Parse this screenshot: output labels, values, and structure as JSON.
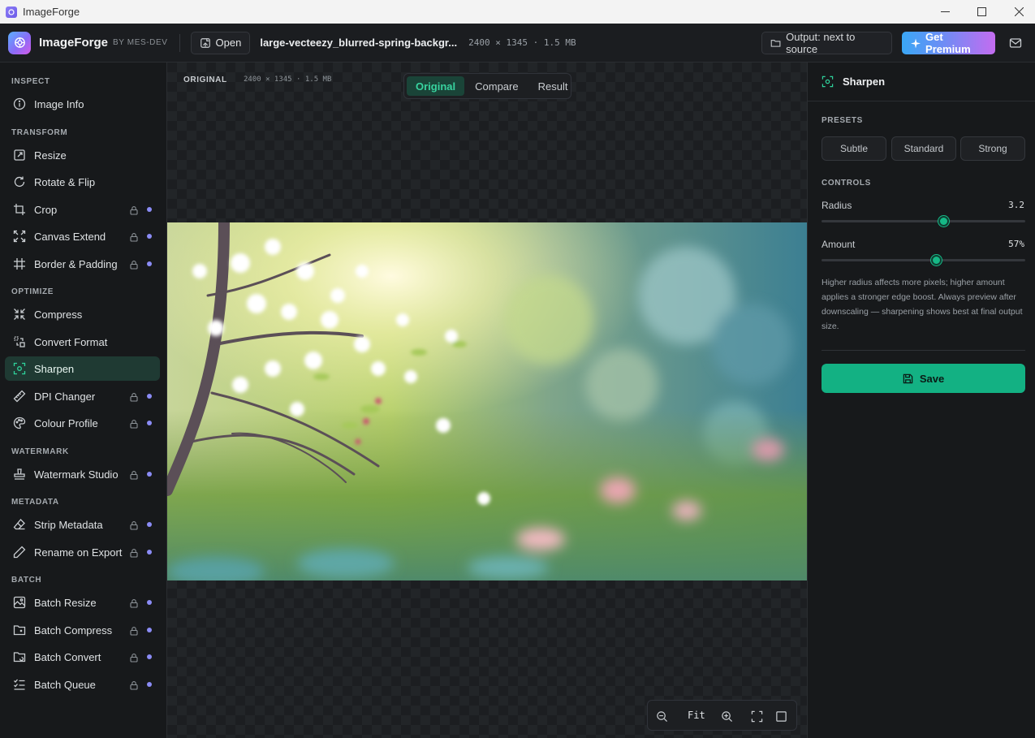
{
  "window": {
    "title": "ImageForge"
  },
  "header": {
    "brand": "ImageForge",
    "brand_by": "BY MES-DEV",
    "open_label": "Open",
    "filename": "large-vecteezy_blurred-spring-backgr...",
    "file_meta": "2400 × 1345 · 1.5 MB",
    "output_label": "Output: next to source",
    "premium_label": "Get Premium"
  },
  "sidebar": {
    "sections": [
      {
        "title": "INSPECT"
      },
      {
        "title": "TRANSFORM"
      },
      {
        "title": "OPTIMIZE"
      },
      {
        "title": "WATERMARK"
      },
      {
        "title": "METADATA"
      },
      {
        "title": "BATCH"
      }
    ],
    "items": [
      {
        "label": "Image Info",
        "icon": "info-icon",
        "locked": false
      },
      {
        "label": "Resize",
        "icon": "resize-icon",
        "locked": false
      },
      {
        "label": "Rotate & Flip",
        "icon": "rotate-icon",
        "locked": false
      },
      {
        "label": "Crop",
        "icon": "crop-icon",
        "locked": true
      },
      {
        "label": "Canvas Extend",
        "icon": "expand-icon",
        "locked": true
      },
      {
        "label": "Border & Padding",
        "icon": "border-icon",
        "locked": true
      },
      {
        "label": "Compress",
        "icon": "compress-icon",
        "locked": false
      },
      {
        "label": "Convert Format",
        "icon": "convert-icon",
        "locked": false
      },
      {
        "label": "Sharpen",
        "icon": "sharpen-icon",
        "locked": false,
        "active": true
      },
      {
        "label": "DPI Changer",
        "icon": "ruler-icon",
        "locked": true
      },
      {
        "label": "Colour Profile",
        "icon": "palette-icon",
        "locked": true
      },
      {
        "label": "Watermark Studio",
        "icon": "stamp-icon",
        "locked": true
      },
      {
        "label": "Strip Metadata",
        "icon": "eraser-icon",
        "locked": true
      },
      {
        "label": "Rename on Export",
        "icon": "pencil-icon",
        "locked": true
      },
      {
        "label": "Batch Resize",
        "icon": "images-icon",
        "locked": true
      },
      {
        "label": "Batch Compress",
        "icon": "folder-compress-icon",
        "locked": true
      },
      {
        "label": "Batch Convert",
        "icon": "folder-convert-icon",
        "locked": true
      },
      {
        "label": "Batch Queue",
        "icon": "list-check-icon",
        "locked": true
      }
    ]
  },
  "canvas": {
    "view_label": "ORIGINAL",
    "view_meta": "2400 × 1345 · 1.5 MB",
    "modes": [
      "Original",
      "Compare",
      "Result"
    ],
    "active_mode": "Original",
    "zoom_label": "Fit"
  },
  "panel": {
    "title": "Sharpen",
    "presets_title": "PRESETS",
    "presets": [
      "Subtle",
      "Standard",
      "Strong"
    ],
    "controls_title": "CONTROLS",
    "radius": {
      "label": "Radius",
      "value": "3.2",
      "fraction": 0.6
    },
    "amount": {
      "label": "Amount",
      "value": "57%",
      "fraction": 0.565
    },
    "help": "Higher radius affects more pixels; higher amount applies a stronger edge boost. Always preview after downscaling — sharpening shows best at final output size.",
    "save_label": "Save"
  },
  "colors": {
    "accent": "#13b183",
    "lock_dot": "#8b8cf6",
    "active_bg": "#1f3a33"
  }
}
